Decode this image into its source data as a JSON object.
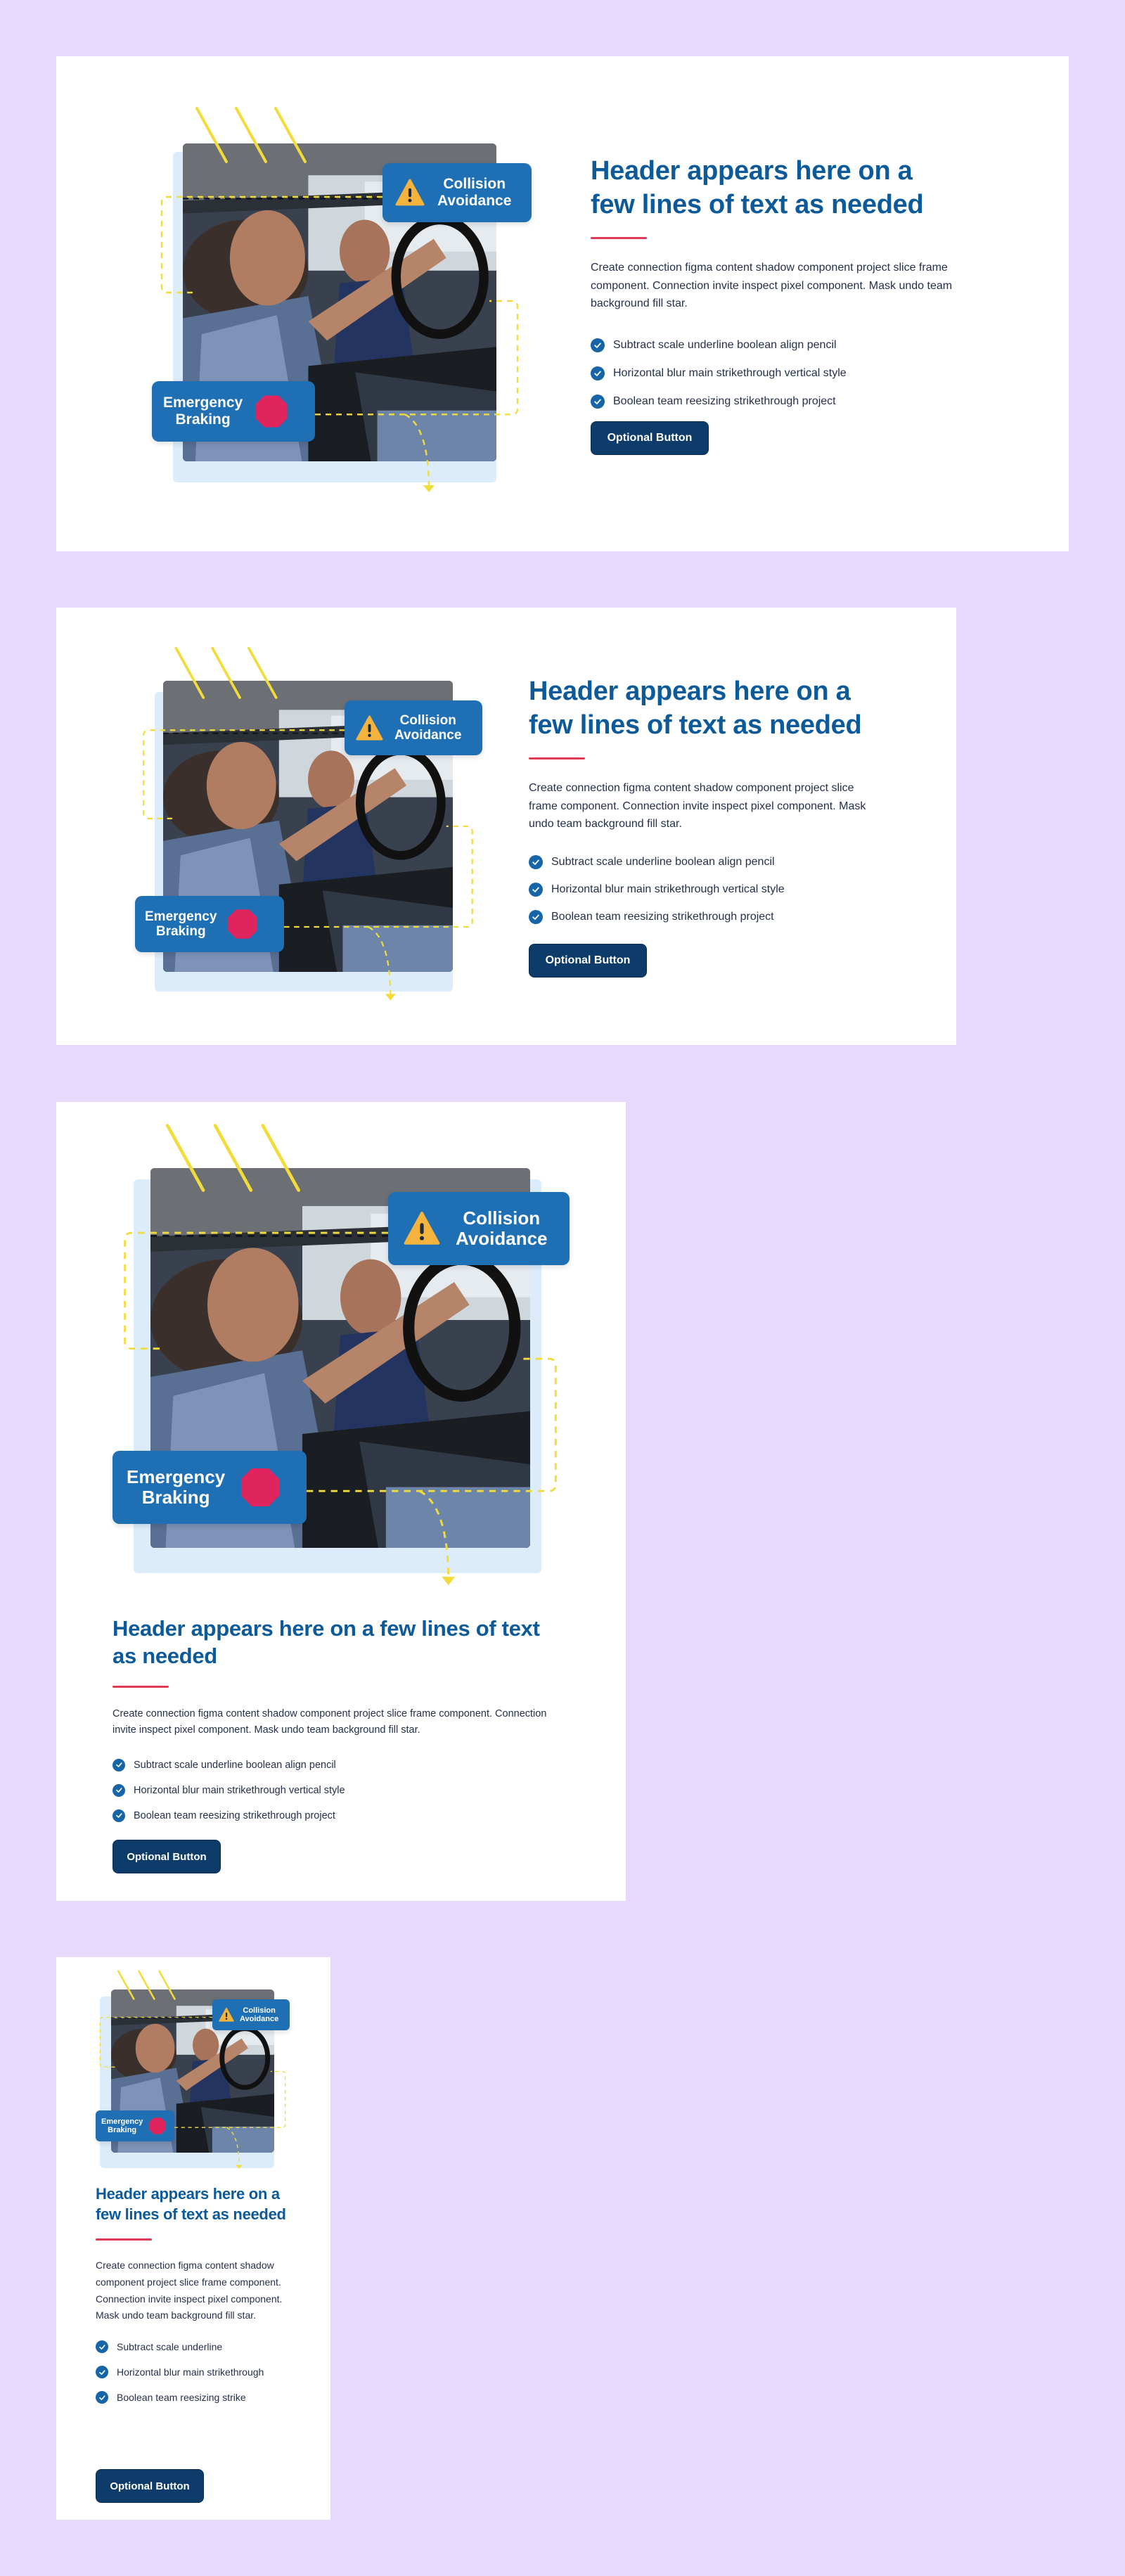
{
  "colors": {
    "background": "#e7d9fd",
    "card": "#ffffff",
    "heading": "#0d5a9a",
    "accent": "#e03a57",
    "badge": "#1e6fb4",
    "button": "#0d3c6b",
    "check": "#1565a8",
    "warning": "#f3b33d",
    "stop": "#e0245e",
    "guide_lines": "#f2dc3c"
  },
  "feature": {
    "badges": {
      "collision": {
        "label": "Collision\nAvoidance",
        "icon": "warning-triangle-icon"
      },
      "braking": {
        "label": "Emergency\nBraking",
        "icon": "stop-octagon-icon"
      }
    },
    "photo": {
      "subject": "driving-lesson-photo"
    },
    "heading": "Header appears here on a few lines of text as needed",
    "description": "Create connection figma content shadow component project slice frame component. Connection invite inspect pixel component. Mask undo team background fill star.",
    "checklist": [
      "Subtract scale underline boolean align pencil",
      "Horizontal blur main strikethrough vertical style",
      "Boolean team reesizing strikethrough project"
    ],
    "checklist_mobile": [
      "Subtract scale underline",
      "Horizontal blur main strikethrough",
      "Boolean team reesizing strike"
    ],
    "button_label": "Optional Button",
    "check_icon": "check-circle-icon"
  }
}
